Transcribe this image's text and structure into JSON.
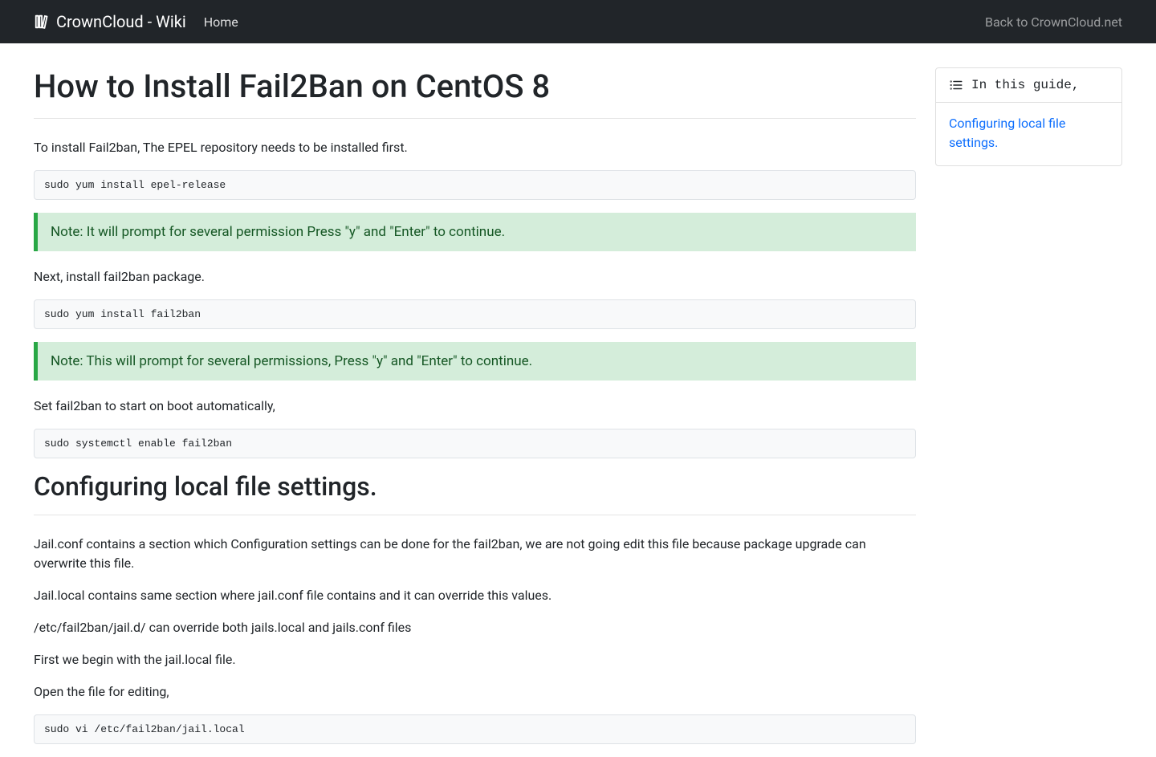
{
  "navbar": {
    "brand": "CrownCloud - Wiki",
    "home": "Home",
    "back": "Back to CrownCloud.net"
  },
  "main": {
    "title": "How to Install Fail2Ban on CentOS 8",
    "p1": "To install Fail2ban, The EPEL repository needs to be installed first.",
    "code1": "sudo yum install epel-release",
    "note1": "Note: It will prompt for several permission Press \"y\" and \"Enter\" to continue.",
    "p2": "Next, install fail2ban package.",
    "code2": "sudo yum install fail2ban",
    "note2": "Note: This will prompt for several permissions, Press \"y\" and \"Enter\" to continue.",
    "p3": "Set fail2ban to start on boot automatically,",
    "code3": "sudo systemctl enable fail2ban",
    "h2": "Configuring local file settings.",
    "p4": "Jail.conf contains a section which Configuration settings can be done for the fail2ban, we are not going edit this file because package upgrade can overwrite this file.",
    "p5": "Jail.local contains same section where jail.conf file contains and it can override this values.",
    "p6": "/etc/fail2ban/jail.d/ can override both jails.local and jails.conf files",
    "p7": "First we begin with the jail.local file.",
    "p8": "Open the file for editing,",
    "code4": "sudo vi /etc/fail2ban/jail.local"
  },
  "sidebar": {
    "title": "In this guide,",
    "link1": "Configuring local file settings."
  }
}
